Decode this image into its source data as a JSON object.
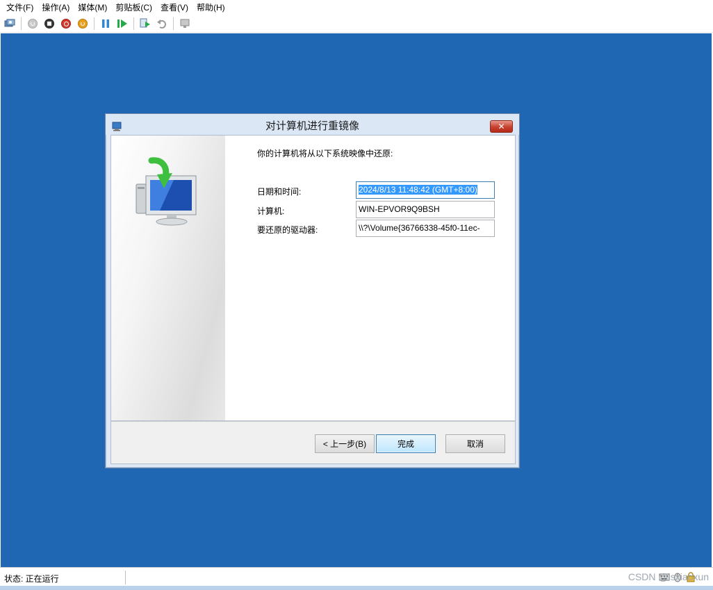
{
  "menu": {
    "items": [
      "文件(F)",
      "操作(A)",
      "媒体(M)",
      "剪贴板(C)",
      "查看(V)",
      "帮助(H)"
    ]
  },
  "toolbar": {
    "buttons": [
      "ctrl-alt-del-icon",
      "start-icon",
      "turn-off-icon",
      "shutdown-icon",
      "power-icon",
      "pause-icon",
      "resume-icon",
      "checkpoint-icon",
      "revert-icon",
      "enhanced-session-icon"
    ]
  },
  "dialog": {
    "title": "对计算机进行重镜像",
    "close_label": "✕",
    "intro": "你的计算机将从以下系统映像中还原:",
    "fields": [
      {
        "label": "日期和时间:",
        "value": "2024/8/13 11:48:42 (GMT+8:00)"
      },
      {
        "label": "计算机:",
        "value": "WIN-EPVOR9Q9BSH"
      },
      {
        "label": "要还原的驱动器:",
        "value": "\\\\?\\Volume{36766338-45f0-11ec-"
      }
    ],
    "buttons": {
      "back": "< 上一步(B)",
      "finish": "完成",
      "cancel": "取消"
    }
  },
  "statusbar": {
    "status": "状态: 正在运行",
    "watermark": "CSDN @isxiaoxun"
  },
  "colors": {
    "vm_background": "#1f66b3",
    "dialog_frame": "#dfe9f6",
    "close_button": "#c7402f",
    "selection": "#3399ff"
  }
}
